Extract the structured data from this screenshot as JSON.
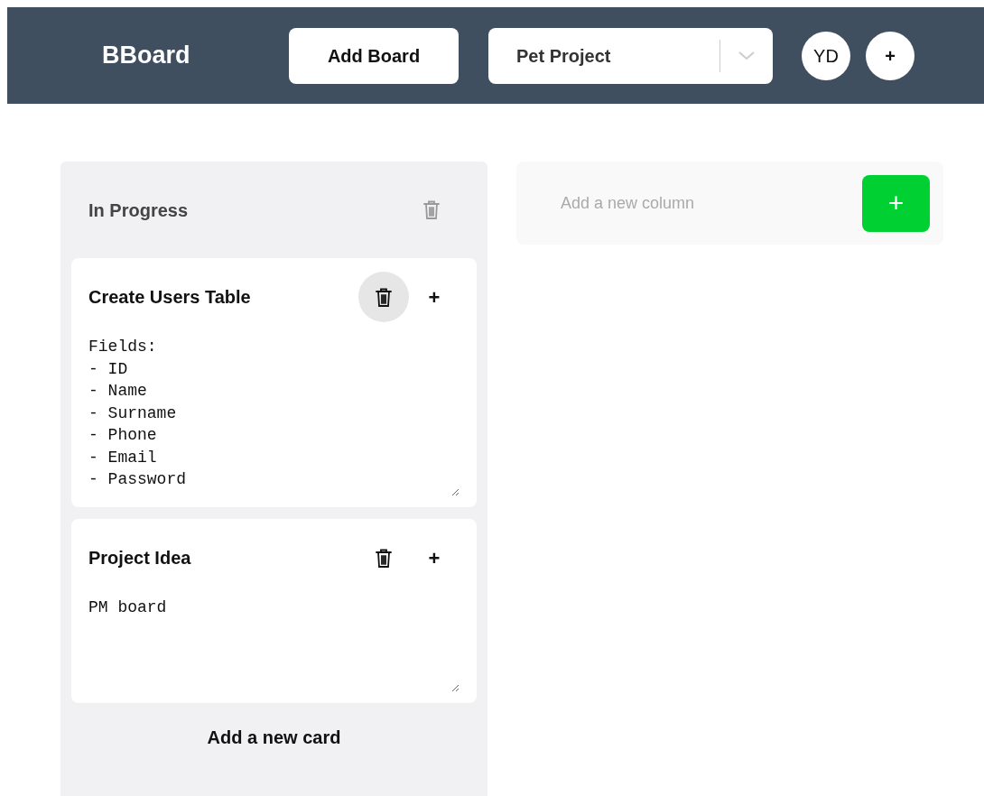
{
  "header": {
    "logo": "BBoard",
    "add_board_button": "Add Board",
    "board_select": {
      "value": "Pet Project"
    },
    "avatar": "YD",
    "add_member_button": "+"
  },
  "columns": [
    {
      "title": "In Progress",
      "cards": [
        {
          "title": "Create Users Table",
          "delete_hovered": true,
          "add_button": "+",
          "body": "Fields:\n- ID\n- Name\n- Surname\n- Phone\n- Email\n- Password"
        },
        {
          "title": "Project Idea",
          "delete_hovered": false,
          "add_button": "+",
          "body": "PM board"
        }
      ],
      "add_card": "Add a new card"
    }
  ],
  "new_column": {
    "placeholder": "Add a new column",
    "add_button": "+"
  }
}
